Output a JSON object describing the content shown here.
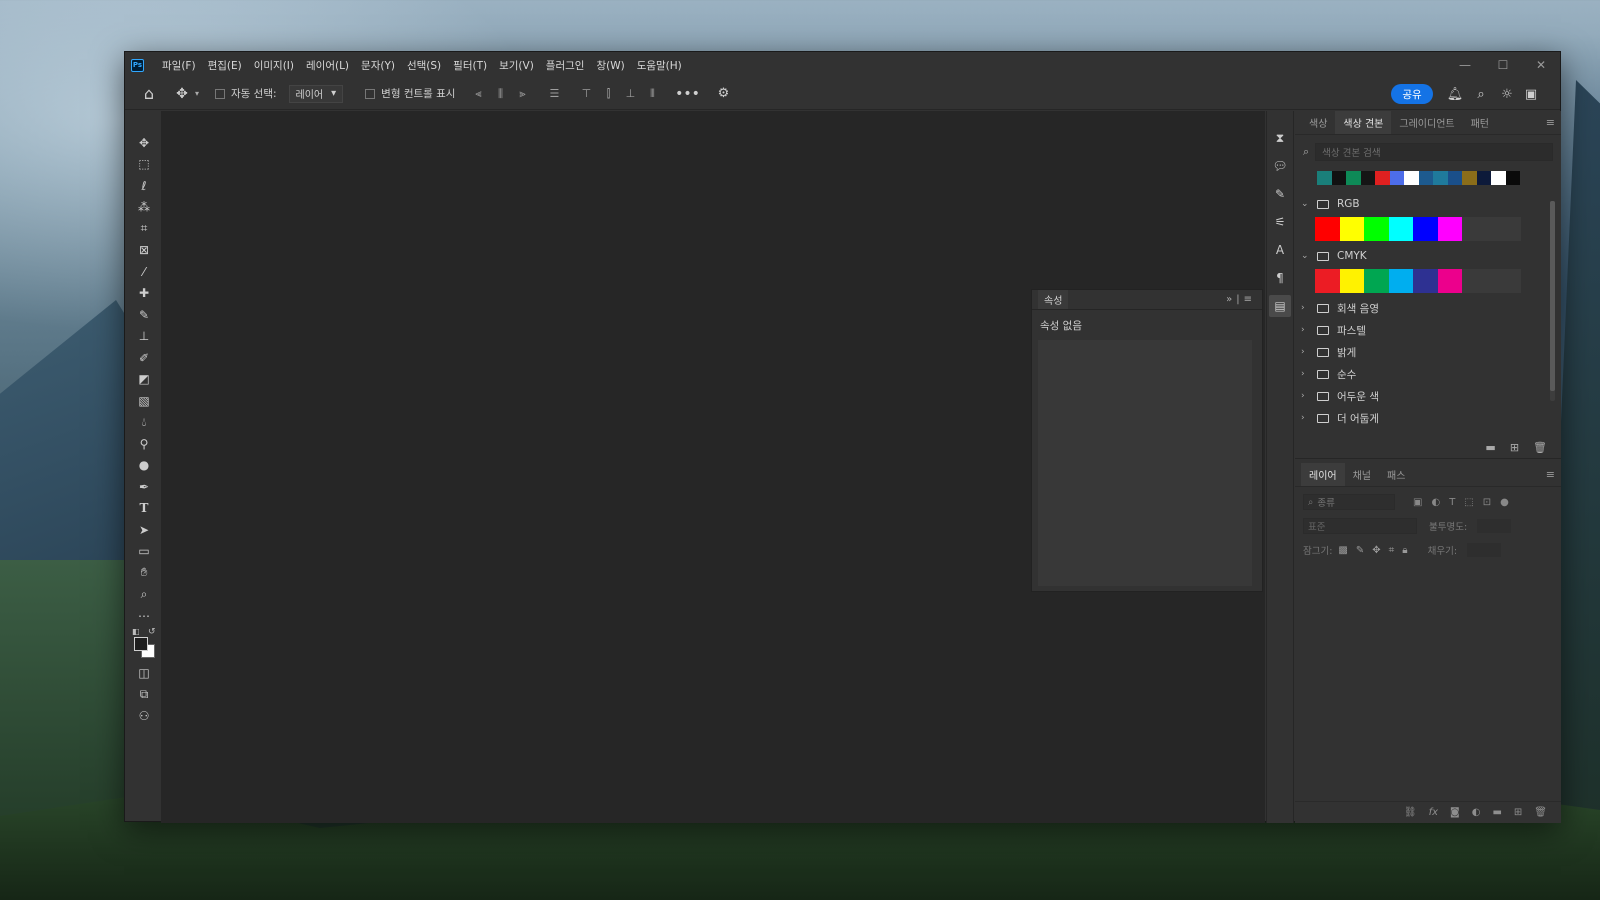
{
  "app": {
    "logo": "Ps",
    "menu": [
      "파일(F)",
      "편집(E)",
      "이미지(I)",
      "레이어(L)",
      "문자(Y)",
      "선택(S)",
      "필터(T)",
      "보기(V)",
      "플러그인",
      "창(W)",
      "도움말(H)"
    ],
    "window_controls": [
      "minimize-icon",
      "maximize-icon",
      "close-icon"
    ]
  },
  "options_bar": {
    "auto_select_label": "자동 선택:",
    "auto_select_value": "레이어",
    "transform_controls_label": "변형 컨트롤 표시",
    "share_label": "공유"
  },
  "properties_panel": {
    "tab": "속성",
    "message": "속성 없음"
  },
  "swatches_panel": {
    "tabs": [
      "색상",
      "색상 견본",
      "그레이디언트",
      "패턴"
    ],
    "active_tab": "색상 견본",
    "search_placeholder": "색상 견본 검색",
    "recent_colors": [
      "#1a7f7a",
      "#111111",
      "#0e8a57",
      "#151515",
      "#e02020",
      "#4d6dea",
      "#ffffff",
      "#1d5a8e",
      "#1f7a9c",
      "#1a4f8a",
      "#8a6d1a",
      "#0d1a3a",
      "#ffffff",
      "#0a0a0a"
    ],
    "groups": [
      {
        "name": "RGB",
        "expanded": true,
        "colors": [
          "#ff0000",
          "#ffff00",
          "#00ff00",
          "#00ffff",
          "#0000ff",
          "#ff00ff"
        ]
      },
      {
        "name": "CMYK",
        "expanded": true,
        "colors": [
          "#ec1c24",
          "#fff200",
          "#00a651",
          "#00aeef",
          "#2e3192",
          "#ec008c"
        ]
      },
      {
        "name": "회색 음영",
        "expanded": false
      },
      {
        "name": "파스텔",
        "expanded": false
      },
      {
        "name": "밝게",
        "expanded": false
      },
      {
        "name": "순수",
        "expanded": false
      },
      {
        "name": "어두운 색",
        "expanded": false
      },
      {
        "name": "더 어둡게",
        "expanded": false
      }
    ]
  },
  "layers_panel": {
    "tabs": [
      "레이어",
      "채널",
      "패스"
    ],
    "active_tab": "레이어",
    "filter_placeholder": "종류",
    "blend_mode": "표준",
    "opacity_label": "불투명도:",
    "lock_label": "잠그기:",
    "fill_label": "채우기:"
  }
}
